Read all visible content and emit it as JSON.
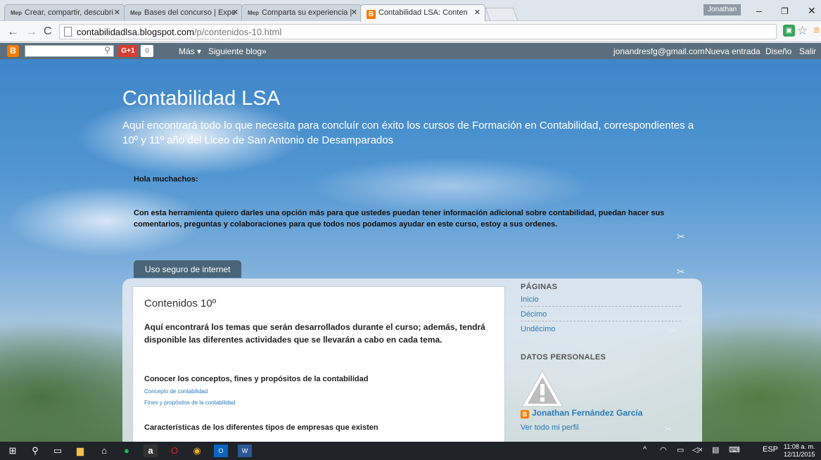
{
  "browser": {
    "tabs": [
      {
        "favicon": "Mep",
        "label": "Crear, compartir, descubri"
      },
      {
        "favicon": "Mep",
        "label": "Bases del concurso | Expe"
      },
      {
        "favicon": "Mep",
        "label": "Comparta su experiencia |"
      },
      {
        "favicon": "B",
        "label": "Contabilidad LSA: Conten"
      }
    ],
    "user": "Jonathan",
    "url_host": "contabilidadlsa.blogspot.com",
    "url_path": "/p/contenidos-10.html"
  },
  "navbar": {
    "gplus": "G+1",
    "gplus_count": "0",
    "more": "Más ▾",
    "next": "Siguiente blog»",
    "email": "jonandresfg@gmail.com",
    "new_post": "Nueva entrada",
    "design": "Diseño",
    "logout": "Salir"
  },
  "blog": {
    "title": "Contabilidad LSA",
    "description": "Aquí encontrará todo lo que necesita para concluír con éxito los cursos de Formación en Contabilidad, correspondientes a 10º y 11º año del Liceo de San Antonio de Desamparados",
    "greeting": "Hola muchachos:",
    "intro": "Con esta herramienta quiero darles una opción más para que ustedes puedan tener información adicional sobre contabilidad, puedan hacer sus comentarios, preguntas y colaboraciones para que todos nos podamos ayudar en este curso, estoy a sus ordenes.",
    "tab": "Uso seguro de internet"
  },
  "post": {
    "title": "Contenidos 10º",
    "lead": "Aquí encontrará los temas que serán desarrollados durante el curso; además, tendrá disponible las diferentes actividades que se llevarán a cabo en cada tema.",
    "section1": "Conocer los conceptos, fines y propósitos de la contabilidad",
    "links1": [
      "Concepto de contabilidad",
      "Fines y propósitos de la contabilidad"
    ],
    "section2": "Características de los diferentes tipos de empresas que existen"
  },
  "sidebar": {
    "pages_heading": "PÁGINAS",
    "pages": [
      "Inicio",
      "Décimo",
      "Undécimo"
    ],
    "profile_heading": "DATOS PERSONALES",
    "profile_name": "Jonathan Fernández García",
    "profile_link": "Ver todo mi perfil"
  },
  "taskbar": {
    "language": "ESP",
    "time": "11:08 a. m.",
    "date": "12/11/2015"
  },
  "colors": {
    "navbar": "#5a6f7e",
    "tab_nav": "#4a6577",
    "link": "#2a7ab8",
    "blogger_orange": "#f57d00"
  }
}
